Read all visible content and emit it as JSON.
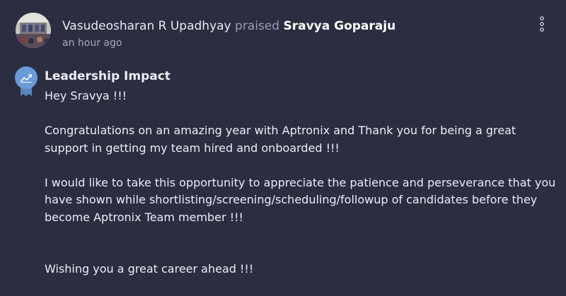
{
  "post": {
    "author": "Vasudeosharan R Upadhyay",
    "action": "praised",
    "recipient": "Sravya Goparaju",
    "timestamp": "an hour ago",
    "badge": {
      "title": "Leadership Impact",
      "icon": "chart-trend-icon",
      "color": "#6a9bd8"
    },
    "message": {
      "greeting": "Hey Sravya !!!",
      "paragraph_1": "Congratulations on an amazing year with Aptronix and Thank you for being a great support in getting my team hired and onboarded !!!",
      "paragraph_2": "I would like to take this opportunity to appreciate the patience and perseverance that you have shown while shortlisting/screening/scheduling/followup of candidates before they become Aptronix Team member !!!",
      "closing": "Wishing you a great career ahead !!!"
    }
  },
  "colors": {
    "background": "#2b2d40",
    "text": "#eceef6",
    "muted": "#9a9cb0"
  }
}
